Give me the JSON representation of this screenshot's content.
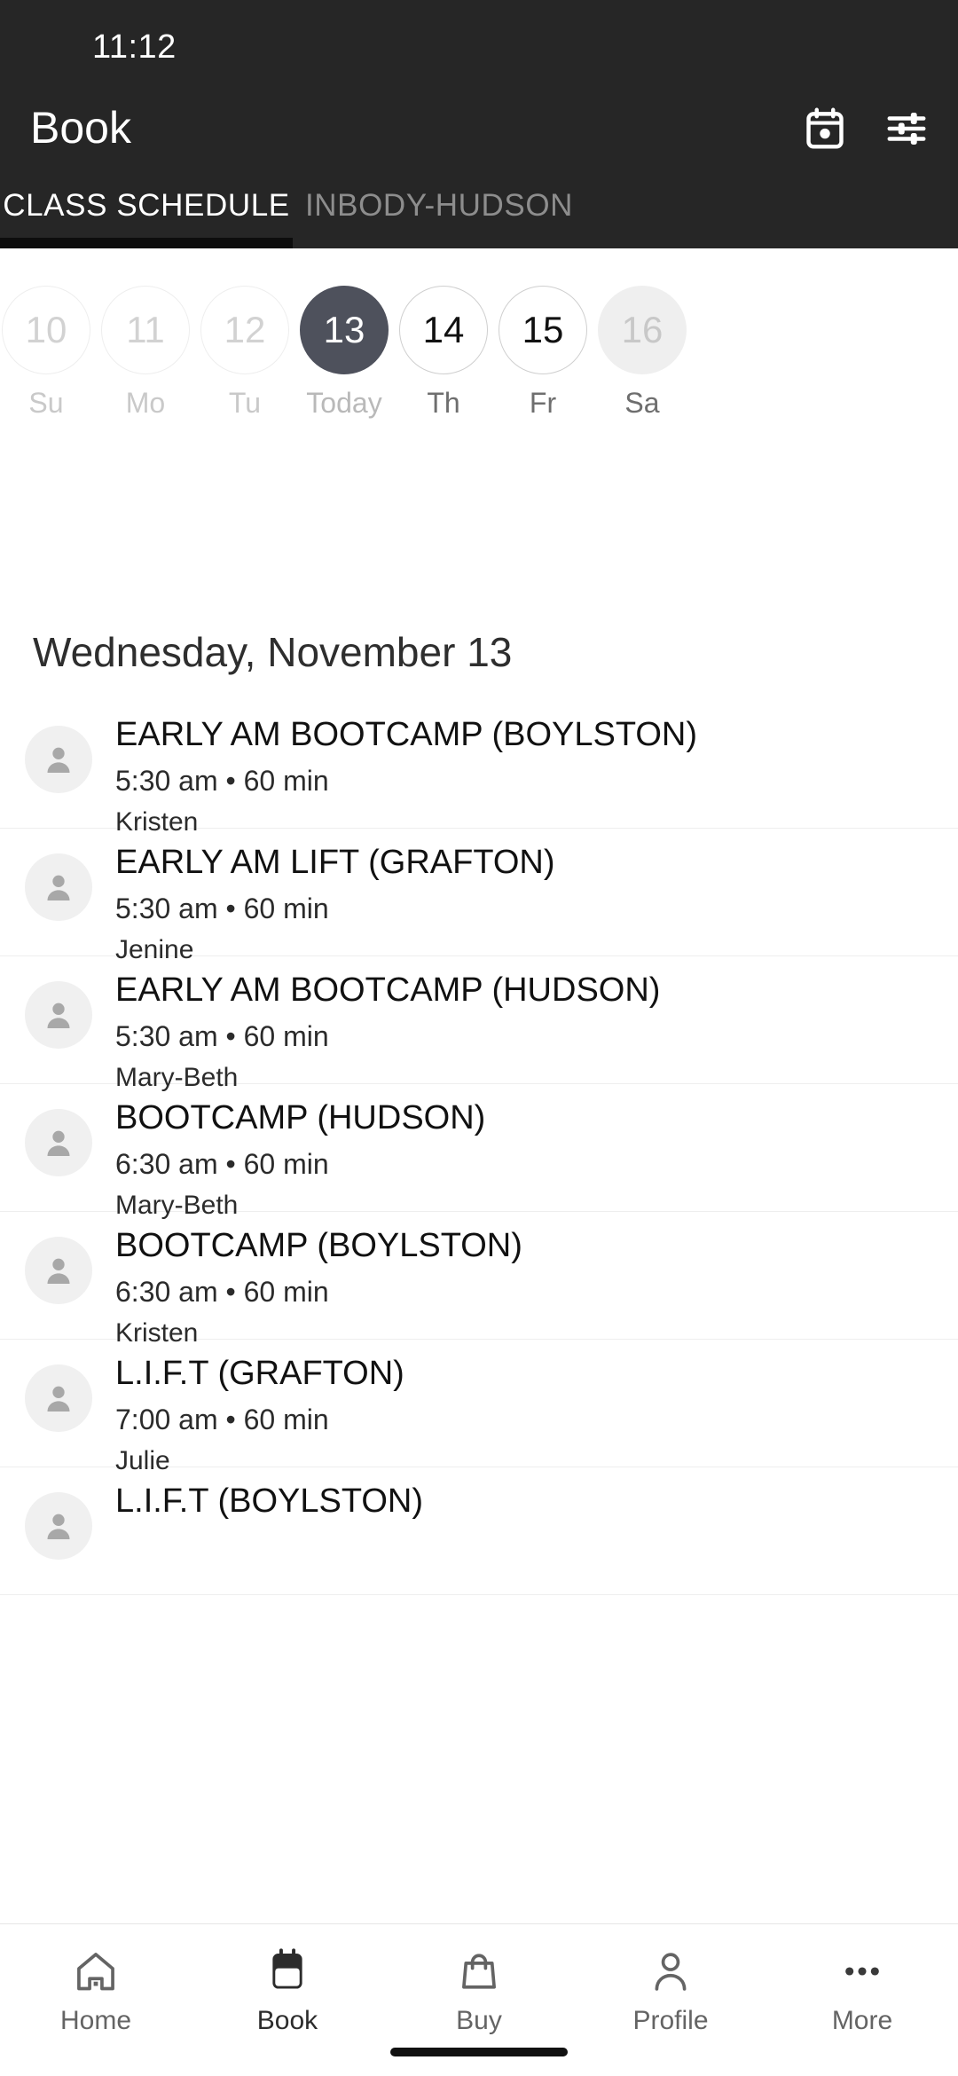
{
  "status_bar": {
    "time": "11:12"
  },
  "app_bar": {
    "title": "Book",
    "actions": [
      {
        "name": "calendar-icon",
        "label": "Calendar"
      },
      {
        "name": "filter-icon",
        "label": "Filter"
      }
    ]
  },
  "tabs": [
    {
      "label": "CLASS SCHEDULE",
      "active": true
    },
    {
      "label": "INBODY-HUDSON",
      "active": false
    }
  ],
  "date_strip": [
    {
      "num": "10",
      "day": "Su",
      "state": "past"
    },
    {
      "num": "11",
      "day": "Mo",
      "state": "past"
    },
    {
      "num": "12",
      "day": "Tu",
      "state": "past"
    },
    {
      "num": "13",
      "day": "Today",
      "state": "today"
    },
    {
      "num": "14",
      "day": "Th",
      "state": "future"
    },
    {
      "num": "15",
      "day": "Fr",
      "state": "future"
    },
    {
      "num": "16",
      "day": "Sa",
      "state": "disabled"
    }
  ],
  "selected_date_heading": "Wednesday, November 13",
  "classes": [
    {
      "title": "EARLY AM BOOTCAMP (BOYLSTON)",
      "meta": "5:30 am • 60 min",
      "coach": "Kristen"
    },
    {
      "title": "EARLY AM LIFT (GRAFTON)",
      "meta": "5:30 am • 60 min",
      "coach": "Jenine"
    },
    {
      "title": "EARLY AM BOOTCAMP (HUDSON)",
      "meta": "5:30 am • 60 min",
      "coach": "Mary-Beth"
    },
    {
      "title": "BOOTCAMP (HUDSON)",
      "meta": "6:30 am • 60 min",
      "coach": "Mary-Beth"
    },
    {
      "title": "BOOTCAMP (BOYLSTON)",
      "meta": "6:30 am • 60 min",
      "coach": "Kristen"
    },
    {
      "title": "L.I.F.T (GRAFTON)",
      "meta": "7:00 am • 60 min",
      "coach": "Julie"
    },
    {
      "title": "L.I.F.T (BOYLSTON)",
      "meta": "",
      "coach": ""
    }
  ],
  "bottom_nav": [
    {
      "label": "Home",
      "icon": "home-icon",
      "active": false
    },
    {
      "label": "Book",
      "icon": "calendar-icon",
      "active": true
    },
    {
      "label": "Buy",
      "icon": "shopping-bag-icon",
      "active": false
    },
    {
      "label": "Profile",
      "icon": "person-icon",
      "active": false
    },
    {
      "label": "More",
      "icon": "more-dots-icon",
      "active": false
    }
  ],
  "colors": {
    "header_bg": "#262626",
    "tab_indicator": "#0d0d0d",
    "today_chip": "#4e515c",
    "page_bg": "#ffffff",
    "divider": "#eeeeee",
    "muted_text": "#646464"
  }
}
